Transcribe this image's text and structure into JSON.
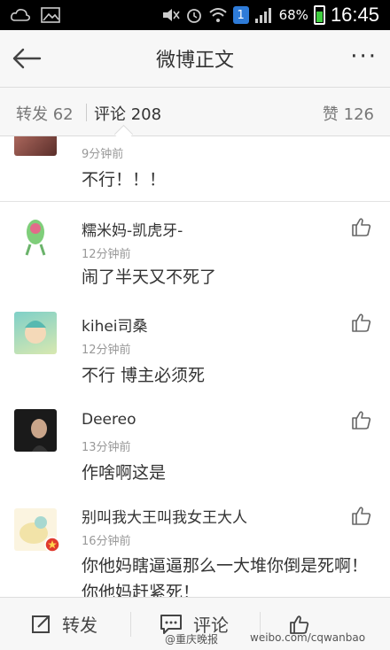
{
  "status": {
    "battery": "68%",
    "time": "16:45",
    "notification_count": "1"
  },
  "header": {
    "title": "微博正文",
    "more": "···"
  },
  "tabs": {
    "repost": "转发 62",
    "comment": "评论 208",
    "like": "赞 126"
  },
  "comments": [
    {
      "name": "",
      "time": "9分钟前",
      "text": "不行！！！"
    },
    {
      "name": "糯米妈-凯虎牙-",
      "time": "12分钟前",
      "text": "闹了半天又不死了"
    },
    {
      "name": "kihei司桑",
      "time": "12分钟前",
      "text": "不行 博主必须死"
    },
    {
      "name": "Deereo",
      "time": "13分钟前",
      "text": "作啥啊这是"
    },
    {
      "name": "别叫我大王叫我女王大人",
      "time": "16分钟前",
      "text": "你他妈瞎逼逼那么一大堆你倒是死啊！你他妈赶紧死！"
    }
  ],
  "bottom": {
    "repost": "转发",
    "comment": "评论"
  },
  "watermark": {
    "left": "@重庆晚报",
    "right": "weibo.com/cqwanbao"
  },
  "colors": {
    "accent": "#3fcf3f",
    "badge": "#2e7bd8"
  }
}
